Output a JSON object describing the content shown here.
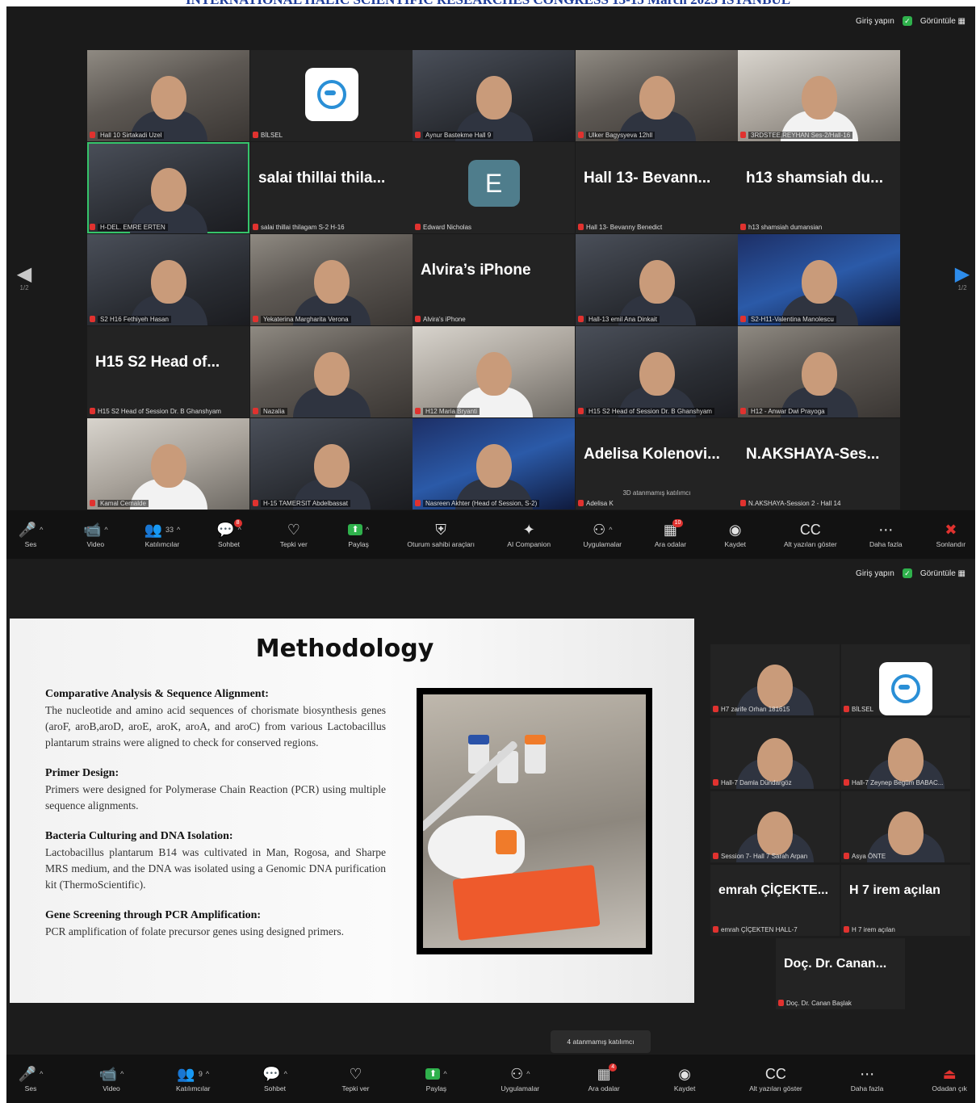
{
  "banner": "INTERNATIONAL HALIC SCIENTIFIC RESEARCHES CONGRESS 13-15 March 2025 ISTANBUL",
  "colors": {
    "accent_green": "#2fb14c",
    "mic_red": "#e0322f",
    "active_border": "#36c46b",
    "slide_title": "#111111"
  },
  "top_bar": {
    "signin": "Giriş yapın",
    "view": "Görüntüle"
  },
  "nav": {
    "page": "1/2"
  },
  "grid1": [
    {
      "label": "Hall 10 Sirtakadi Uzel",
      "kind": "video"
    },
    {
      "label": "BİLSEL",
      "kind": "logo"
    },
    {
      "label": "Aynur Bastekme Hall 9",
      "kind": "video"
    },
    {
      "label": "Ulker Bagysyeva 12hll",
      "kind": "video"
    },
    {
      "label": "3RDSTEE.REYHAN Ses-2/Hall-16",
      "kind": "video"
    },
    {
      "label": "H-DEL. EMRE ERTEN",
      "kind": "video"
    },
    {
      "label": "salai thillai thilagam S-2 H-16",
      "kind": "name",
      "big": "salai thillai thila..."
    },
    {
      "label": "Edward Nicholas",
      "kind": "avatar",
      "letter": "E"
    },
    {
      "label": "Hall 13- Bevanny Benedict",
      "kind": "name",
      "big": "Hall 13- Bevann..."
    },
    {
      "label": "h13 shamsiah dumansian",
      "kind": "name",
      "big": "h13 shamsiah du..."
    },
    {
      "label": "S2 H16 Fethiyeh Hasan",
      "kind": "video"
    },
    {
      "label": "Yekaterina Margharita Verona",
      "kind": "video"
    },
    {
      "label": "Alvira's iPhone",
      "kind": "name",
      "big": "Alvira’s iPhone"
    },
    {
      "label": "Hall-13 emil Ana Dinkait",
      "kind": "video"
    },
    {
      "label": "S2-H11-Valentina Manolescu",
      "kind": "video"
    },
    {
      "label": "H15 S2 Head of Session Dr. B Ghanshyam",
      "kind": "name",
      "big": "H15 S2 Head of..."
    },
    {
      "label": "Nazalia",
      "kind": "video"
    },
    {
      "label": "H12 Maria Bryanti",
      "kind": "video"
    },
    {
      "label": "H15 S2 Head of Session Dr. B Ghanshyam",
      "kind": "video"
    },
    {
      "label": "H12 - Anwar Dwi Prayoga",
      "kind": "video"
    },
    {
      "label": "Kamal Cemalde",
      "kind": "video"
    },
    {
      "label": "H-15 TAMERSIT Abdelbassat",
      "kind": "video"
    },
    {
      "label": "Nasreen Akhter (Head of Session, S-2)",
      "kind": "video"
    },
    {
      "label": "Adelisa K",
      "kind": "name",
      "big": "Adelisa Kolenovi...",
      "sub": "3D atanmamış katılımcı"
    },
    {
      "label": "N.AKSHAYA-Session 2 - Hall 14",
      "kind": "name",
      "big": "N.AKSHAYA-Ses..."
    }
  ],
  "toolbar1": [
    {
      "icon": "🎤",
      "label": "Ses",
      "name": "audio"
    },
    {
      "icon": "📹",
      "label": "Video",
      "name": "video"
    },
    {
      "icon": "👥",
      "label": "Katılımcılar",
      "name": "participants",
      "count": "33"
    },
    {
      "icon": "💬",
      "label": "Sohbet",
      "name": "chat",
      "badge": "8"
    },
    {
      "icon": "♡",
      "label": "Tepki ver",
      "name": "react"
    },
    {
      "icon": "⬆",
      "label": "Paylaş",
      "name": "share"
    },
    {
      "icon": "⛨",
      "label": "Oturum sahibi araçları",
      "name": "host-tools"
    },
    {
      "icon": "✦",
      "label": "AI Companion",
      "name": "ai-companion"
    },
    {
      "icon": "⚇",
      "label": "Uygulamalar",
      "name": "apps"
    },
    {
      "icon": "▦",
      "label": "Ara odalar",
      "name": "breakout",
      "badge": "10"
    },
    {
      "icon": "◉",
      "label": "Kaydet",
      "name": "record"
    },
    {
      "icon": "CC",
      "label": "Alt yazıları göster",
      "name": "captions"
    },
    {
      "icon": "⋯",
      "label": "Daha fazla",
      "name": "more"
    },
    {
      "icon": "✖",
      "label": "Sonlandır",
      "name": "end"
    }
  ],
  "slide": {
    "title": "Methodology",
    "sections": [
      {
        "heading": "Comparative Analysis & Sequence Alignment:",
        "body": "The nucleotide and amino acid sequences of chorismate biosynthesis genes (aroF, aroB,aroD, aroE, aroK, aroA, and aroC) from various Lactobacillus plantarum strains were aligned to check for conserved regions."
      },
      {
        "heading": "Primer Design:",
        "body": "Primers were designed for Polymerase Chain Reaction (PCR) using multiple sequence alignments."
      },
      {
        "heading": "Bacteria Culturing and DNA Isolation:",
        "body": "Lactobacillus plantarum B14 was cultivated in Man, Rogosa, and Sharpe MRS medium, and the DNA was isolated using a Genomic DNA purification kit (ThermoScientific)."
      },
      {
        "heading": "Gene Screening through PCR Amplification:",
        "body": "PCR amplification of folate precursor genes using designed primers."
      }
    ]
  },
  "grid2": [
    {
      "label": "H7 zarife Orhan 181615",
      "kind": "video"
    },
    {
      "label": "BİLSEL",
      "kind": "logo"
    },
    {
      "label": "Hall-7 Damla Dündargöz",
      "kind": "video"
    },
    {
      "label": "Hall-7 Zeynep Begüm BABAC...",
      "kind": "video"
    },
    {
      "label": "Session 7- Hall 7 Sarah Arpan",
      "kind": "video"
    },
    {
      "label": "Asya ÖNTE",
      "kind": "video"
    },
    {
      "label": "emrah ÇİÇEKTEN HALL-7",
      "kind": "name",
      "big": "emrah ÇİÇEKTE..."
    },
    {
      "label": "H 7 irem açılan",
      "kind": "name",
      "big": "H 7 irem açılan"
    },
    {
      "label": "Doç. Dr. Canan Başlak",
      "kind": "name",
      "big": "Doç. Dr. Canan..."
    }
  ],
  "toast": "4 atanmamış katılımcı",
  "toolbar2": [
    {
      "icon": "🎤",
      "label": "Ses",
      "name": "audio"
    },
    {
      "icon": "📹",
      "label": "Video",
      "name": "video"
    },
    {
      "icon": "👥",
      "label": "Katılımcılar",
      "name": "participants",
      "count": "9"
    },
    {
      "icon": "💬",
      "label": "Sohbet",
      "name": "chat"
    },
    {
      "icon": "♡",
      "label": "Tepki ver",
      "name": "react"
    },
    {
      "icon": "⬆",
      "label": "Paylaş",
      "name": "share"
    },
    {
      "icon": "⚇",
      "label": "Uygulamalar",
      "name": "apps"
    },
    {
      "icon": "▦",
      "label": "Ara odalar",
      "name": "breakout",
      "badge": "4"
    },
    {
      "icon": "◉",
      "label": "Kaydet",
      "name": "record"
    },
    {
      "icon": "CC",
      "label": "Alt yazıları göster",
      "name": "captions"
    },
    {
      "icon": "⋯",
      "label": "Daha fazla",
      "name": "more"
    },
    {
      "icon": "⏏",
      "label": "Odadan çık",
      "name": "leave"
    }
  ]
}
